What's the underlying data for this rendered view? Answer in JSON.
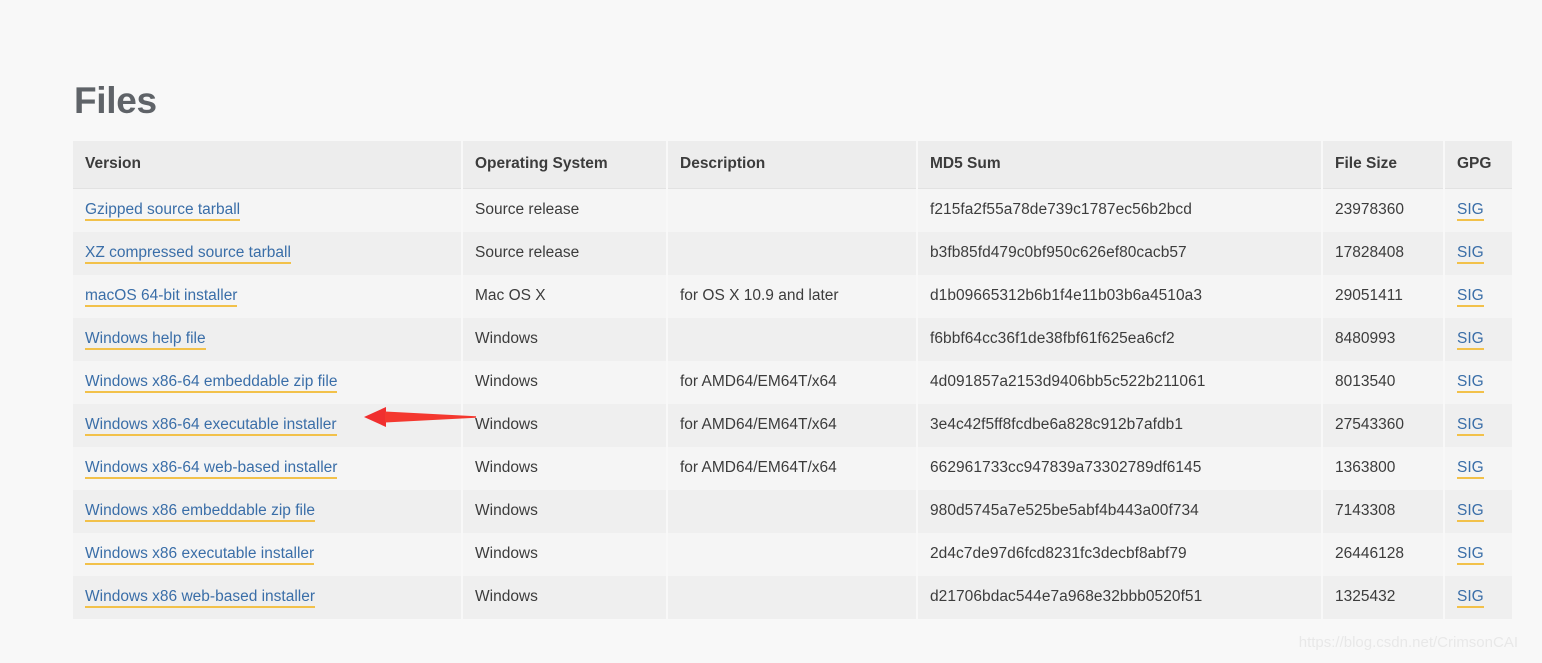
{
  "page": {
    "title": "Files",
    "watermark": "https://blog.csdn.net/CrimsonCAI"
  },
  "colors": {
    "heading": "#5f6368",
    "link": "#3a6ea8",
    "link_underline": "#f2c14a",
    "header_bg": "#ededed",
    "row_odd_bg": "#f5f5f5",
    "row_even_bg": "#efefef",
    "page_bg": "#f8f8f8",
    "annotation_arrow": "#f02f2f"
  },
  "table": {
    "columns": [
      {
        "key": "version",
        "label": "Version"
      },
      {
        "key": "os",
        "label": "Operating System"
      },
      {
        "key": "description",
        "label": "Description"
      },
      {
        "key": "md5",
        "label": "MD5 Sum"
      },
      {
        "key": "size",
        "label": "File Size"
      },
      {
        "key": "gpg",
        "label": "GPG"
      }
    ],
    "rows": [
      {
        "version": "Gzipped source tarball",
        "os": "Source release",
        "description": "",
        "md5": "f215fa2f55a78de739c1787ec56b2bcd",
        "size": "23978360",
        "gpg": "SIG"
      },
      {
        "version": "XZ compressed source tarball",
        "os": "Source release",
        "description": "",
        "md5": "b3fb85fd479c0bf950c626ef80cacb57",
        "size": "17828408",
        "gpg": "SIG"
      },
      {
        "version": "macOS 64-bit installer",
        "os": "Mac OS X",
        "description": "for OS X 10.9 and later",
        "md5": "d1b09665312b6b1f4e11b03b6a4510a3",
        "size": "29051411",
        "gpg": "SIG"
      },
      {
        "version": "Windows help file",
        "os": "Windows",
        "description": "",
        "md5": "f6bbf64cc36f1de38fbf61f625ea6cf2",
        "size": "8480993",
        "gpg": "SIG"
      },
      {
        "version": "Windows x86-64 embeddable zip file",
        "os": "Windows",
        "description": "for AMD64/EM64T/x64",
        "md5": "4d091857a2153d9406bb5c522b211061",
        "size": "8013540",
        "gpg": "SIG"
      },
      {
        "version": "Windows x86-64 executable installer",
        "os": "Windows",
        "description": "for AMD64/EM64T/x64",
        "md5": "3e4c42f5ff8fcdbe6a828c912b7afdb1",
        "size": "27543360",
        "gpg": "SIG"
      },
      {
        "version": "Windows x86-64 web-based installer",
        "os": "Windows",
        "description": "for AMD64/EM64T/x64",
        "md5": "662961733cc947839a73302789df6145",
        "size": "1363800",
        "gpg": "SIG"
      },
      {
        "version": "Windows x86 embeddable zip file",
        "os": "Windows",
        "description": "",
        "md5": "980d5745a7e525be5abf4b443a00f734",
        "size": "7143308",
        "gpg": "SIG"
      },
      {
        "version": "Windows x86 executable installer",
        "os": "Windows",
        "description": "",
        "md5": "2d4c7de97d6fcd8231fc3decbf8abf79",
        "size": "26446128",
        "gpg": "SIG"
      },
      {
        "version": "Windows x86 web-based installer",
        "os": "Windows",
        "description": "",
        "md5": "d21706bdac544e7a968e32bbb0520f51",
        "size": "1325432",
        "gpg": "SIG"
      }
    ]
  },
  "annotation": {
    "type": "arrow",
    "direction": "left",
    "target_row_index": 5,
    "target_label": "Windows x86-64 executable installer"
  }
}
